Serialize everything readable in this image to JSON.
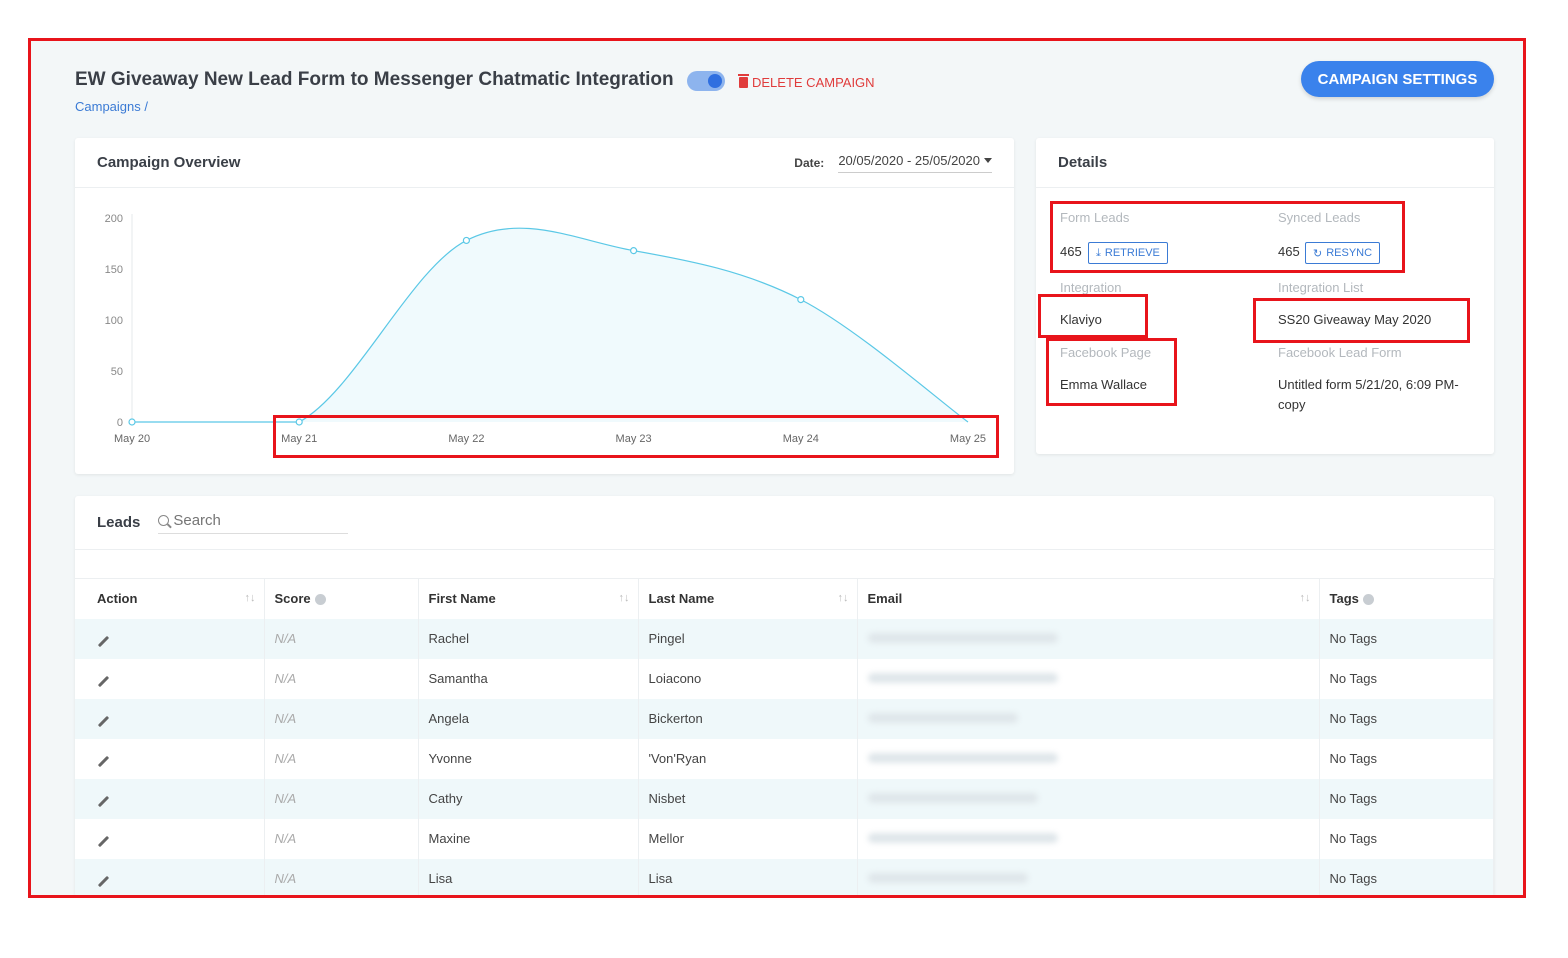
{
  "header": {
    "title": "EW Giveaway New Lead Form to Messenger Chatmatic Integration",
    "delete_label": "DELETE CAMPAIGN",
    "breadcrumb": "Campaigns /",
    "settings_label": "CAMPAIGN SETTINGS"
  },
  "overview": {
    "title": "Campaign Overview",
    "date_label": "Date:",
    "date_value": "20/05/2020 - 25/05/2020"
  },
  "chart_data": {
    "type": "area",
    "categories": [
      "May 20",
      "May 21",
      "May 22",
      "May 23",
      "May 24",
      "May 25"
    ],
    "values": [
      0,
      0,
      178,
      168,
      120,
      0
    ],
    "ylim": [
      0,
      200
    ],
    "yticks": [
      "0",
      "50",
      "100",
      "150",
      "200"
    ],
    "grid": false,
    "line_color": "#5bc8e6",
    "fill_color": "#f0fafd"
  },
  "details": {
    "title": "Details",
    "form_leads_label": "Form Leads",
    "form_leads_value": "465",
    "retrieve_label": "RETRIEVE",
    "synced_leads_label": "Synced Leads",
    "synced_leads_value": "465",
    "resync_label": "RESYNC",
    "integration_label": "Integration",
    "integration_value": "Klaviyo",
    "integration_list_label": "Integration List",
    "integration_list_value": "SS20 Giveaway May 2020",
    "facebook_page_label": "Facebook Page",
    "facebook_page_value": "Emma Wallace",
    "facebook_form_label": "Facebook Lead Form",
    "facebook_form_value": "Untitled form 5/21/20, 6:09 PM-copy"
  },
  "leads": {
    "title": "Leads",
    "search_placeholder": "Search",
    "columns": [
      "Action",
      "Score",
      "First Name",
      "Last Name",
      "Email",
      "Tags"
    ],
    "rows": [
      {
        "score": "N/A",
        "first": "Rachel",
        "last": "Pingel",
        "tags": "No Tags"
      },
      {
        "score": "N/A",
        "first": "Samantha",
        "last": "Loiacono",
        "tags": "No Tags"
      },
      {
        "score": "N/A",
        "first": "Angela",
        "last": "Bickerton",
        "tags": "No Tags"
      },
      {
        "score": "N/A",
        "first": "Yvonne",
        "last": "'Von'Ryan",
        "tags": "No Tags"
      },
      {
        "score": "N/A",
        "first": "Cathy",
        "last": "Nisbet",
        "tags": "No Tags"
      },
      {
        "score": "N/A",
        "first": "Maxine",
        "last": "Mellor",
        "tags": "No Tags"
      },
      {
        "score": "N/A",
        "first": "Lisa",
        "last": "Lisa",
        "tags": "No Tags"
      }
    ]
  }
}
